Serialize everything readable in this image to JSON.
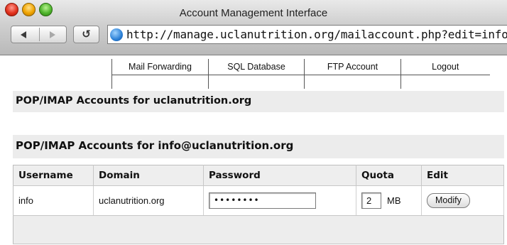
{
  "window": {
    "title": "Account Management Interface",
    "url": "http://manage.uclanutrition.org/mailaccount.php?edit=info"
  },
  "nav": {
    "items": [
      "Mail Forwarding",
      "SQL Database",
      "FTP Account",
      "Logout"
    ]
  },
  "sections": {
    "domain_title": "POP/IMAP Accounts for uclanutrition.org",
    "account_title": "POP/IMAP Accounts for info@uclanutrition.org"
  },
  "table": {
    "headers": [
      "Username",
      "Domain",
      "Password",
      "Quota",
      "Edit"
    ],
    "row": {
      "username": "info",
      "domain": "uclanutrition.org",
      "password_masked": "••••••••",
      "quota": "2",
      "quota_unit": "MB",
      "edit_label": "Modify"
    }
  }
}
